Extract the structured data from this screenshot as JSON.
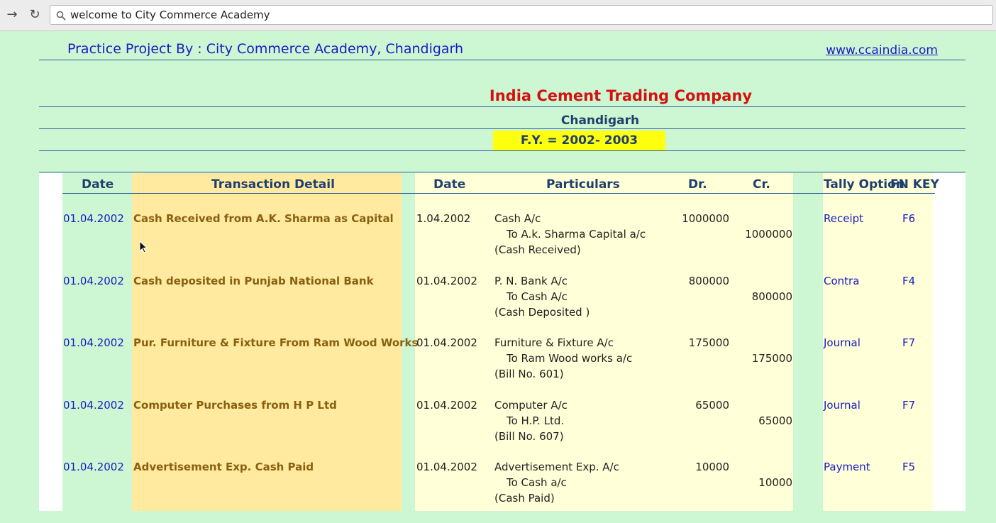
{
  "browser": {
    "url": "welcome to City Commerce Academy"
  },
  "sheet": {
    "header_left": "Practice Project By : City Commerce Academy, Chandigarh",
    "header_right": "www.ccaindia.com",
    "company": "India Cement Trading Company",
    "city": "Chandigarh",
    "fy": "F.Y. =  2002- 2003"
  },
  "table": {
    "headers": {
      "date1": "Date",
      "detail": "Transaction Detail",
      "date2": "Date",
      "particulars": "Particulars",
      "dr": "Dr.",
      "cr": "Cr.",
      "tally": "Tally Option",
      "fnkey": "FN  KEY"
    },
    "rows": [
      {
        "date": "01.04.2002",
        "detail": "Cash Received from A.K. Sharma as Capital",
        "entry_date": "1.04.2002",
        "p1": "Cash A/c",
        "p2": "To A.k. Sharma Capital a/c",
        "p3": "(Cash Received)",
        "dr": "1000000",
        "cr": "1000000",
        "option": "Receipt",
        "fn": "F6"
      },
      {
        "date": "01.04.2002",
        "detail": "Cash deposited in Punjab National Bank",
        "entry_date": "01.04.2002",
        "p1": "P. N. Bank A/c",
        "p2": "To Cash A/c",
        "p3": "(Cash Deposited )",
        "dr": "800000",
        "cr": "800000",
        "option": "Contra",
        "fn": "F4"
      },
      {
        "date": "01.04.2002",
        "detail": "Pur. Furniture & Fixture From Ram Wood Works",
        "entry_date": "01.04.2002",
        "p1": "Furniture & Fixture A/c",
        "p2": "To Ram Wood works a/c",
        "p3": "(Bill No. 601)",
        "dr": "175000",
        "cr": "175000",
        "option": "Journal",
        "fn": "F7"
      },
      {
        "date": "01.04.2002",
        "detail": "Computer Purchases from H P Ltd",
        "entry_date": "01.04.2002",
        "p1": "Computer A/c",
        "p2": "To H.P. Ltd.",
        "p3": "(Bill No. 607)",
        "dr": "65000",
        "cr": "65000",
        "option": "Journal",
        "fn": "F7"
      },
      {
        "date": "01.04.2002",
        "detail": "Advertisement Exp. Cash Paid",
        "entry_date": "01.04.2002",
        "p1": "Advertisement Exp. A/c",
        "p2": "To Cash a/c",
        "p3": "(Cash Paid)",
        "dr": "10000",
        "cr": "10000",
        "option": "Payment",
        "fn": "F5"
      }
    ]
  }
}
